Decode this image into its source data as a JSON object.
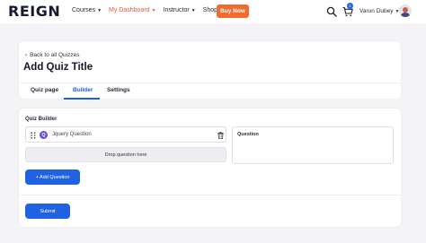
{
  "nav": {
    "logo": "REIGN",
    "menu": [
      {
        "label": "Courses",
        "active": false
      },
      {
        "label": "My Dashboard",
        "active": true
      },
      {
        "label": "Instructor",
        "active": false
      },
      {
        "label": "Shop",
        "active": false
      }
    ],
    "buy_now": "Buy Now",
    "cart_count": "1",
    "user_name": "Varun Dubey",
    "icons": {
      "search": "search-icon",
      "cart": "cart-icon",
      "chevron": "chevron-down-icon"
    },
    "colors": {
      "accent": "#f26b2e",
      "active_link": "#e4583f"
    }
  },
  "header": {
    "back_link": "Back to all Quizzes",
    "title": "Add Quiz Title",
    "tabs": [
      {
        "label": "Quiz page",
        "active": false
      },
      {
        "label": "Builder",
        "active": true
      },
      {
        "label": "Settings",
        "active": false
      }
    ]
  },
  "builder": {
    "label": "Quiz Builder",
    "question": {
      "badge": "Q",
      "text": "Jquery Question"
    },
    "drop_text": "Drop question here",
    "panel_label": "Question",
    "add_button": "+ Add Question",
    "submit_button": "Submit",
    "colors": {
      "primary": "#1f63e3",
      "badge": "#6d4bd0"
    }
  }
}
